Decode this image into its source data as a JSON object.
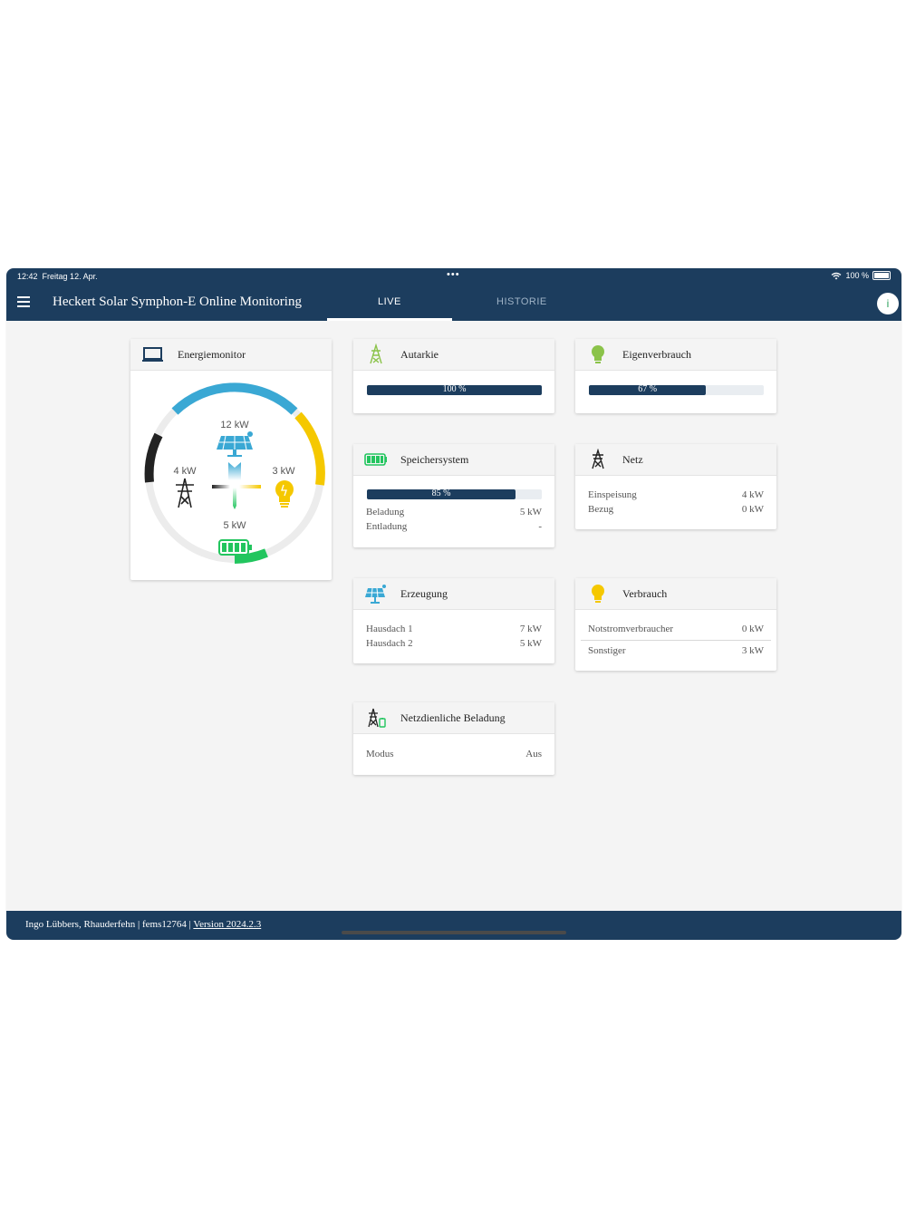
{
  "status": {
    "time": "12:42",
    "date": "Freitag 12. Apr.",
    "battery": "100 %"
  },
  "app": {
    "title": "Heckert Solar Symphon-E Online Monitoring",
    "tabs": [
      "LIVE",
      "HISTORIE"
    ],
    "info_label": "i"
  },
  "energiemonitor": {
    "title": "Energiemonitor",
    "production": "12 kW",
    "grid": "4 kW",
    "consumption": "3 kW",
    "storage": "5 kW"
  },
  "autarkie": {
    "title": "Autarkie",
    "bar_label": "100 %",
    "percent": 100
  },
  "eigenverbrauch": {
    "title": "Eigenverbrauch",
    "bar_label": "67 %",
    "percent": 67
  },
  "speicher": {
    "title": "Speichersystem",
    "bar_label": "85 %",
    "percent": 85,
    "rows": [
      {
        "label": "Beladung",
        "value": "5 kW"
      },
      {
        "label": "Entladung",
        "value": "-"
      }
    ]
  },
  "netz": {
    "title": "Netz",
    "rows": [
      {
        "label": "Einspeisung",
        "value": "4 kW"
      },
      {
        "label": "Bezug",
        "value": "0 kW"
      }
    ]
  },
  "erzeugung": {
    "title": "Erzeugung",
    "rows": [
      {
        "label": "Hausdach 1",
        "value": "7 kW"
      },
      {
        "label": "Hausdach 2",
        "value": "5 kW"
      }
    ]
  },
  "verbrauch": {
    "title": "Verbrauch",
    "rows": [
      {
        "label": "Notstromverbraucher",
        "value": "0 kW"
      },
      {
        "label": "Sonstiger",
        "value": "3 kW"
      }
    ]
  },
  "netzdienlich": {
    "title": "Netzdienliche Beladung",
    "rows": [
      {
        "label": "Modus",
        "value": "Aus"
      }
    ]
  },
  "footer": {
    "text": "Ingo Lübbers, Rhauderfehn | fems12764 | ",
    "version": "Version 2024.2.3"
  },
  "colors": {
    "navy": "#1c3d5e",
    "production": "#3aa8d4",
    "consumption": "#f5c800",
    "storage": "#22c55e",
    "grid": "#222222"
  }
}
